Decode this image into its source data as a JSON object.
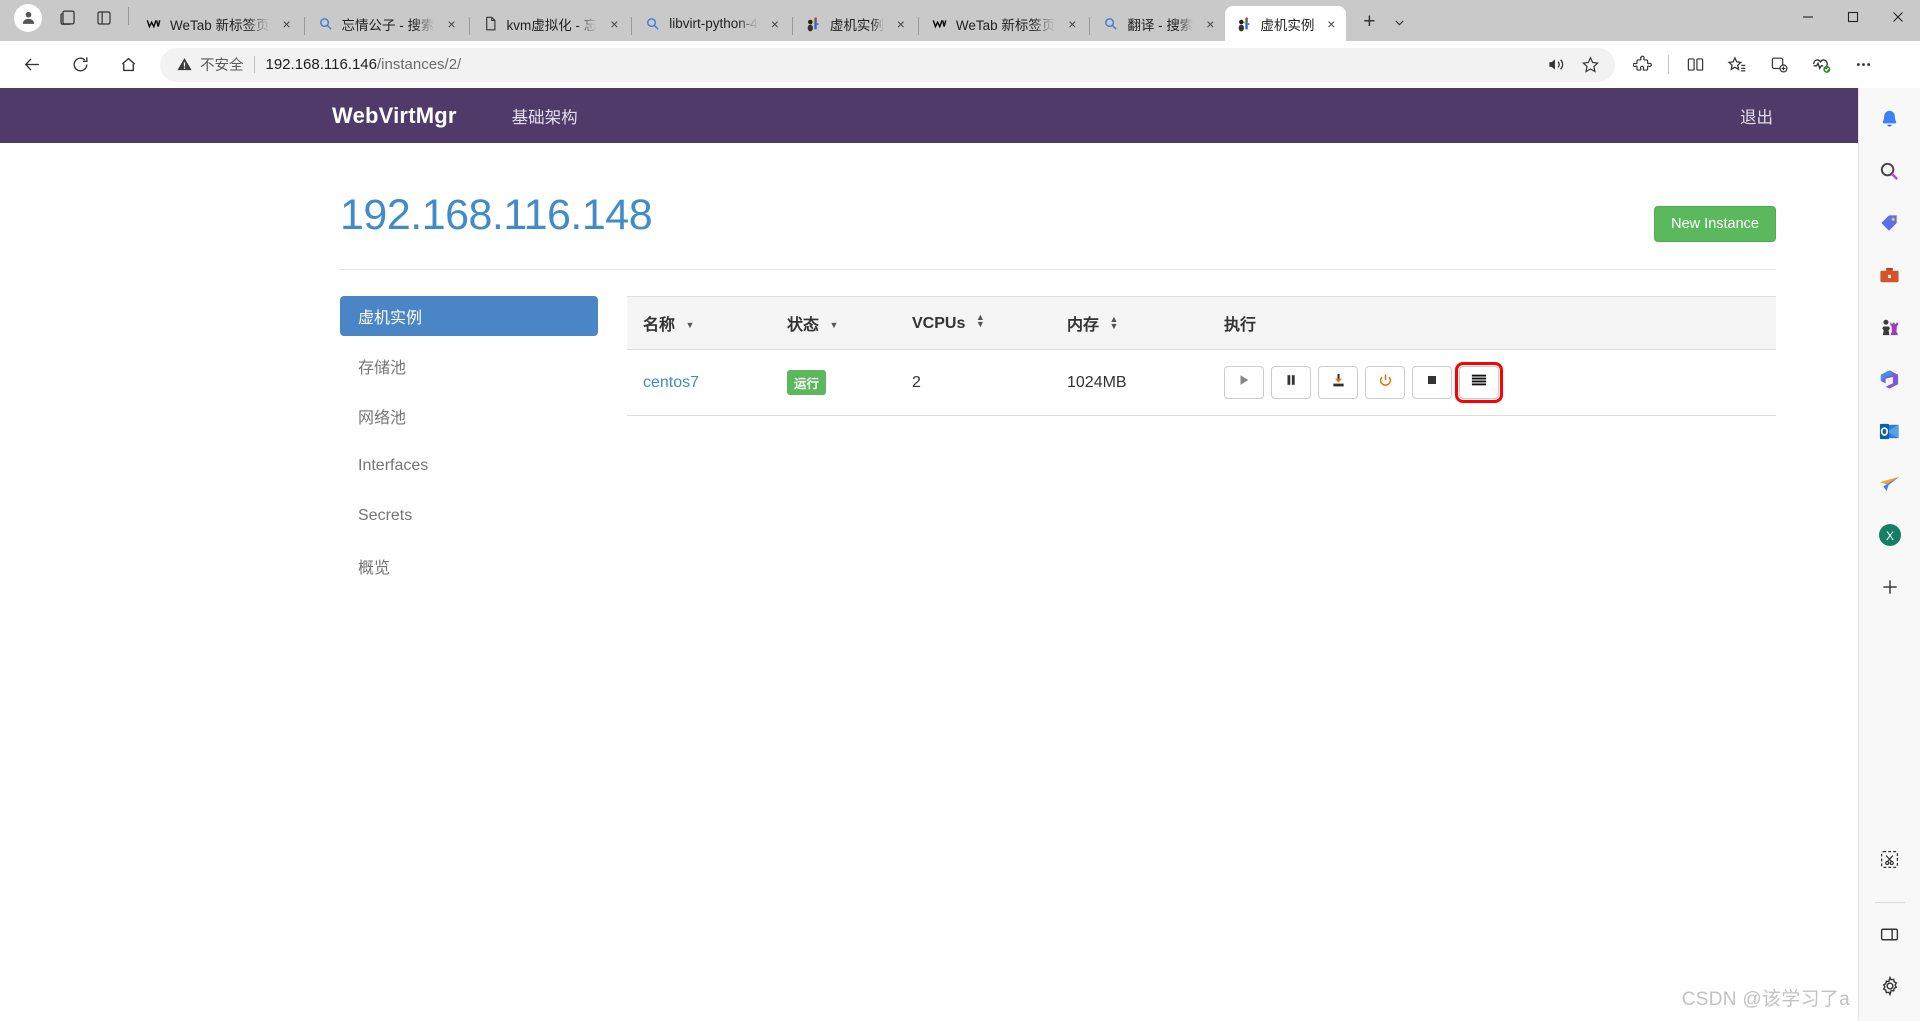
{
  "browser": {
    "profile_icon": "account-icon",
    "workspaces_icon": "workspaces-icon",
    "tab_actions_icon": "tab-actions-icon",
    "tabs": [
      {
        "label": "WeTab 新标签页",
        "icon": "wetab-icon",
        "active": false,
        "close": "×"
      },
      {
        "label": "忘情公子 - 搜索",
        "icon": "bing-search-icon",
        "active": false,
        "close": "×"
      },
      {
        "label": "kvm虚拟化 - 忘",
        "icon": "document-icon",
        "active": false,
        "close": "×"
      },
      {
        "label": "libvirt-python-4",
        "icon": "bing-search-icon",
        "active": false,
        "close": "×"
      },
      {
        "label": "虚机实例",
        "icon": "webvirtmgr-icon",
        "active": false,
        "close": "×"
      },
      {
        "label": "WeTab 新标签页",
        "icon": "wetab-icon",
        "active": false,
        "close": "×"
      },
      {
        "label": "翻译 - 搜索",
        "icon": "bing-search-icon",
        "active": false,
        "close": "×"
      },
      {
        "label": "虚机实例",
        "icon": "webvirtmgr-icon",
        "active": true,
        "close": "×"
      }
    ],
    "new_tab_label": "+",
    "tab_menu_icon": "chevron-down-icon",
    "window_controls": {
      "minimize": "—",
      "maximize": "▢",
      "close": "✕"
    },
    "nav": {
      "back_icon": "back-arrow-icon",
      "refresh_icon": "refresh-icon",
      "home_icon": "home-icon"
    },
    "omnibox": {
      "warning_icon": "warning-triangle-icon",
      "security_label": "不安全",
      "url_host": "192.168.116.146",
      "url_path": "/instances/2/",
      "read_aloud_icon": "read-aloud-icon",
      "favorite_icon": "star-icon"
    },
    "toolbar_icons": [
      {
        "name": "extensions-icon"
      },
      {
        "name": "split-screen-icon"
      },
      {
        "name": "favorites-icon"
      },
      {
        "name": "collections-icon"
      },
      {
        "name": "browser-essentials-icon"
      },
      {
        "name": "settings-more-icon"
      }
    ]
  },
  "app": {
    "brand": "WebVirtMgr",
    "nav_link": "基础架构",
    "logout": "退出",
    "brand_color": "#503a69",
    "title": "192.168.116.148",
    "title_color": "#428bca",
    "new_instance_label": "New Instance",
    "new_instance_color": "#5cb85c",
    "sidebar": [
      {
        "label": "虚机实例",
        "active": true
      },
      {
        "label": "存储池",
        "active": false
      },
      {
        "label": "网络池",
        "active": false
      },
      {
        "label": "Interfaces",
        "active": false
      },
      {
        "label": "Secrets",
        "active": false
      },
      {
        "label": "概览",
        "active": false
      }
    ],
    "table": {
      "columns": [
        {
          "label": "名称",
          "sort": "desc"
        },
        {
          "label": "状态",
          "sort": "desc"
        },
        {
          "label": "VCPUs",
          "sort": "both"
        },
        {
          "label": "内存",
          "sort": "both"
        },
        {
          "label": "执行",
          "sort": "none"
        }
      ],
      "rows": [
        {
          "name": "centos7",
          "status": "运行",
          "status_color": "#5cb85c",
          "vcpus": "2",
          "memory": "1024MB",
          "actions": [
            {
              "name": "start-button",
              "icon": "play-icon",
              "highlight": false
            },
            {
              "name": "pause-button",
              "icon": "pause-icon",
              "highlight": false
            },
            {
              "name": "snapshot-button",
              "icon": "save-download-icon",
              "highlight": false
            },
            {
              "name": "poweroff-button",
              "icon": "power-icon",
              "highlight": false
            },
            {
              "name": "forceoff-button",
              "icon": "stop-icon",
              "highlight": false
            },
            {
              "name": "console-button",
              "icon": "list-menu-icon",
              "highlight": true
            }
          ]
        }
      ]
    }
  },
  "edgebar": {
    "icons": [
      {
        "name": "notifications-bell-icon"
      },
      {
        "name": "search-icon"
      },
      {
        "name": "shopping-tag-icon"
      },
      {
        "name": "briefcase-icon"
      },
      {
        "name": "games-chess-icon"
      },
      {
        "name": "microsoft-365-icon"
      },
      {
        "name": "outlook-icon"
      },
      {
        "name": "send-plane-icon"
      },
      {
        "name": "excel-x-icon"
      },
      {
        "name": "add-sidebar-icon"
      }
    ],
    "bottom_icons": [
      {
        "name": "screenshot-snip-icon"
      },
      {
        "name": "split-panel-icon"
      },
      {
        "name": "settings-gear-icon"
      }
    ]
  },
  "watermark": "CSDN @该学习了a"
}
